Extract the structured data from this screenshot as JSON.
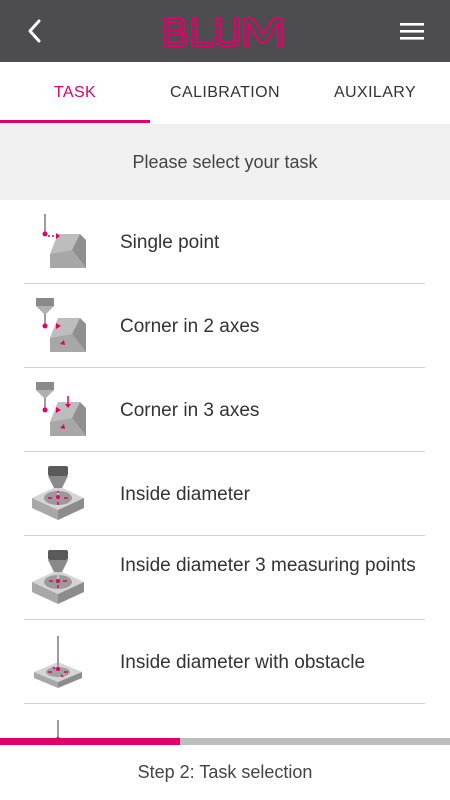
{
  "header": {
    "logo_text": "BLUM",
    "back_icon": "chevron-left-icon",
    "menu_icon": "hamburger-menu-icon"
  },
  "tabs": [
    {
      "label": "TASK",
      "active": true
    },
    {
      "label": "CALIBRATION",
      "active": false
    },
    {
      "label": "AUXILARY",
      "active": false
    }
  ],
  "prompt": "Please select your task",
  "tasks": [
    {
      "label": "Single point",
      "icon": "single-point-icon"
    },
    {
      "label": "Corner in 2 axes",
      "icon": "corner-2-axes-icon"
    },
    {
      "label": "Corner in 3 axes",
      "icon": "corner-3-axes-icon"
    },
    {
      "label": "Inside diameter",
      "icon": "inside-diameter-icon"
    },
    {
      "label": "Inside diameter 3 measuring points",
      "icon": "inside-diameter-3-points-icon"
    },
    {
      "label": "Inside diameter with obstacle",
      "icon": "inside-diameter-obstacle-icon"
    }
  ],
  "progress": {
    "fraction": 0.4
  },
  "footer": {
    "step_text": "Step 2: Task selection"
  },
  "colors": {
    "accent": "#e2006a",
    "appbar": "#4d4d4f",
    "prompt_bg": "#f0f0f0"
  }
}
